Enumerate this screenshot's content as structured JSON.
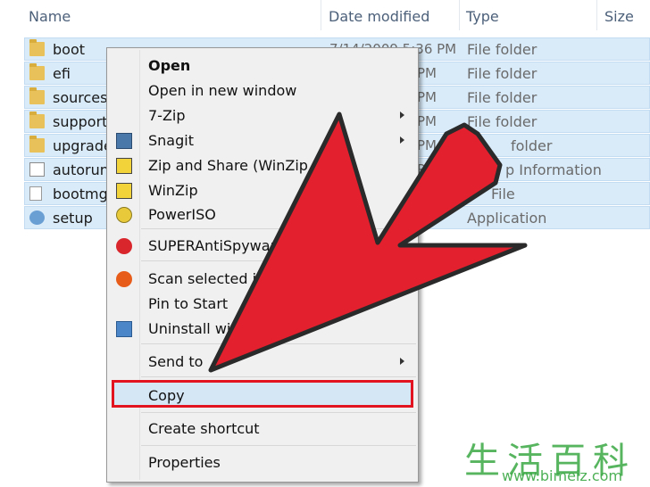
{
  "columns": {
    "name": "Name",
    "date_modified": "Date modified",
    "type": "Type",
    "size": "Size"
  },
  "files": [
    {
      "name": "boot",
      "date": "7/14/2009 5:36 PM",
      "type": "File folder",
      "icon": "folder-icon"
    },
    {
      "name": "efi",
      "date": "PM",
      "type": "File folder",
      "icon": "folder-icon"
    },
    {
      "name": "sources",
      "date": "PM",
      "type": "File folder",
      "icon": "folder-icon"
    },
    {
      "name": "support",
      "date": "PM",
      "type": "File folder",
      "icon": "folder-icon"
    },
    {
      "name": "upgrade",
      "date": "PM",
      "type": "folder",
      "icon": "folder-icon"
    },
    {
      "name": "autorun",
      "date": "PM",
      "type": "p Information",
      "icon": "setup-info-icon"
    },
    {
      "name": "bootmgr",
      "date": "",
      "type": "File",
      "icon": "file-icon"
    },
    {
      "name": "setup",
      "date": "PM",
      "type": "Application",
      "icon": "application-icon"
    }
  ],
  "context_menu": {
    "open": "Open",
    "open_new_window": "Open in new window",
    "seven_zip": "7-Zip",
    "snagit": "Snagit",
    "zip_and_share": "Zip and Share (WinZip Exp",
    "winzip": "WinZip",
    "poweriso": "PowerISO",
    "superantispyware": "SUPERAntiSpyware",
    "scan_selected": "Scan selected item",
    "pin_to_start": "Pin to Start",
    "uninstall_with": "Uninstall with",
    "send_to": "Send to",
    "copy": "Copy",
    "create_shortcut": "Create shortcut",
    "properties": "Properties"
  },
  "annotation": {
    "arrow_color": "#e2202e",
    "highlight_color": "#e2141f"
  },
  "watermark": {
    "chars": "生活百科",
    "url": "www.bimeiz.com"
  }
}
